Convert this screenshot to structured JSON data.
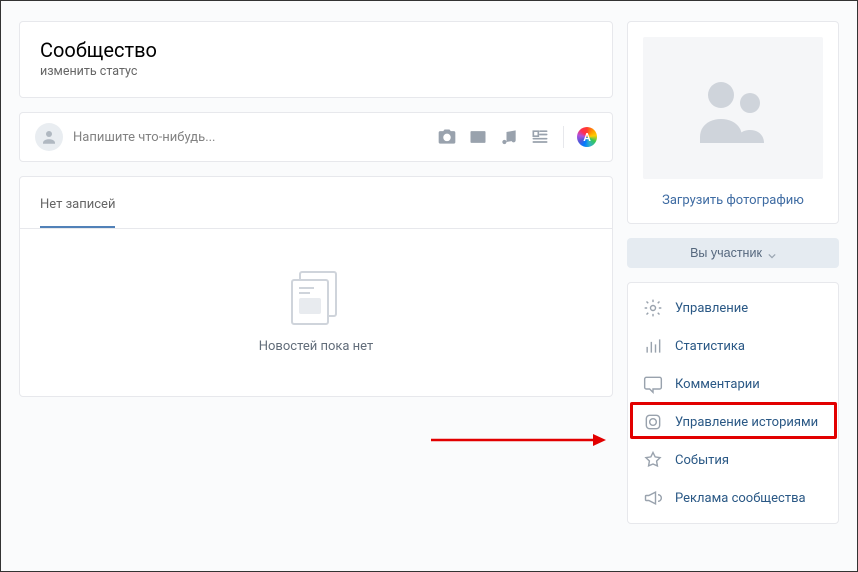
{
  "header": {
    "title": "Сообщество",
    "change_status": "изменить статус"
  },
  "composer": {
    "placeholder": "Напишите что-нибудь...",
    "ads_letter": "A"
  },
  "feed": {
    "tab_label": "Нет записей",
    "empty_text": "Новостей пока нет"
  },
  "photo_panel": {
    "upload_label": "Загрузить фотографию"
  },
  "member_button": {
    "label": "Вы участник"
  },
  "sidebar_menu": {
    "items": [
      {
        "label": "Управление"
      },
      {
        "label": "Статистика"
      },
      {
        "label": "Комментарии"
      },
      {
        "label": "Управление историями"
      },
      {
        "label": "События"
      },
      {
        "label": "Реклама сообщества"
      }
    ]
  }
}
